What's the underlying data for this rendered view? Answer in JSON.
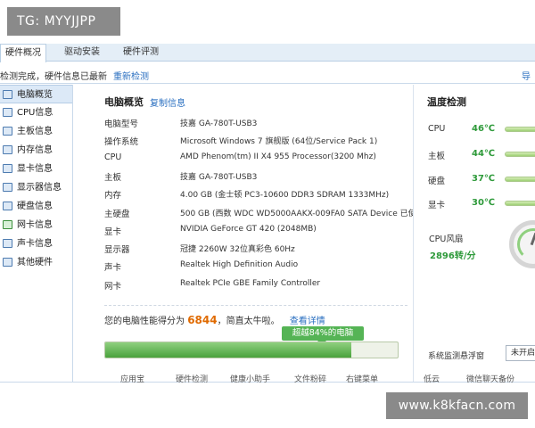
{
  "overlay_tag": "TG: MYYJJPP",
  "tabs": [
    "硬件概况",
    "驱动安装",
    "硬件评测"
  ],
  "status": {
    "text": "检测完成，硬件信息已最新",
    "rescan": "重新检测",
    "export": "导"
  },
  "sidebar": {
    "items": [
      {
        "label": "电脑概览"
      },
      {
        "label": "CPU信息"
      },
      {
        "label": "主板信息"
      },
      {
        "label": "内存信息"
      },
      {
        "label": "显卡信息"
      },
      {
        "label": "显示器信息"
      },
      {
        "label": "硬盘信息"
      },
      {
        "label": "网卡信息"
      },
      {
        "label": "声卡信息"
      },
      {
        "label": "其他硬件"
      }
    ]
  },
  "overview": {
    "title": "电脑概览",
    "copy_label": "复制信息",
    "rows": [
      {
        "label": "电脑型号",
        "value": "技嘉 GA-780T-USB3"
      },
      {
        "label": "操作系统",
        "value": "Microsoft Windows 7 旗舰版 (64位/Service Pack 1)"
      },
      {
        "label": "CPU",
        "value": "AMD Phenom(tm) II X4 955 Processor(3200 Mhz)"
      },
      {
        "label": "主板",
        "value": "技嘉 GA-780T-USB3"
      },
      {
        "label": "内存",
        "value": "4.00 GB (金士顿 PC3-10600 DDR3 SDRAM 1333MHz)"
      },
      {
        "label": "主硬盘",
        "value": "500 GB (西数 WDC WD5000AAKX-009FA0 SATA Device 已使…"
      },
      {
        "label": "显卡",
        "value": "NVIDIA GeForce GT 420 (2048MB)"
      },
      {
        "label": "显示器",
        "value": "冠捷 2260W 32位真彩色 60Hz"
      },
      {
        "label": "声卡",
        "value": "Realtek High Definition Audio"
      },
      {
        "label": "网卡",
        "value": "Realtek PCIe GBE Family Controller"
      }
    ]
  },
  "score": {
    "prefix": "您的电脑性能得分为",
    "value": "6844",
    "suffix": "，简直太牛啦。",
    "detail_link": "查看详情",
    "bubble": "超越84%的电脑",
    "percent": 84
  },
  "temperature": {
    "title": "温度检测",
    "rows": [
      {
        "label": "CPU",
        "value": "46℃"
      },
      {
        "label": "主板",
        "value": "44℃"
      },
      {
        "label": "硬盘",
        "value": "37℃"
      },
      {
        "label": "显卡",
        "value": "30℃"
      }
    ],
    "fan_label": "CPU风扇",
    "fan_speed": "2896转/分",
    "monitor_label": "系统监测悬浮窗",
    "monitor_button": "未开启"
  },
  "bottom_bar": [
    "应用宝",
    "硬件检测",
    "健康小助手",
    "文件粉碎",
    "右键菜单",
    "低云",
    "微信聊天备份"
  ],
  "watermark": "www.k8kfacn.com",
  "colors": {
    "accent_blue": "#2a6fc0",
    "good_green": "#2e9a3a",
    "score_orange": "#e06a00",
    "tab_bg": "#e4eef7"
  }
}
